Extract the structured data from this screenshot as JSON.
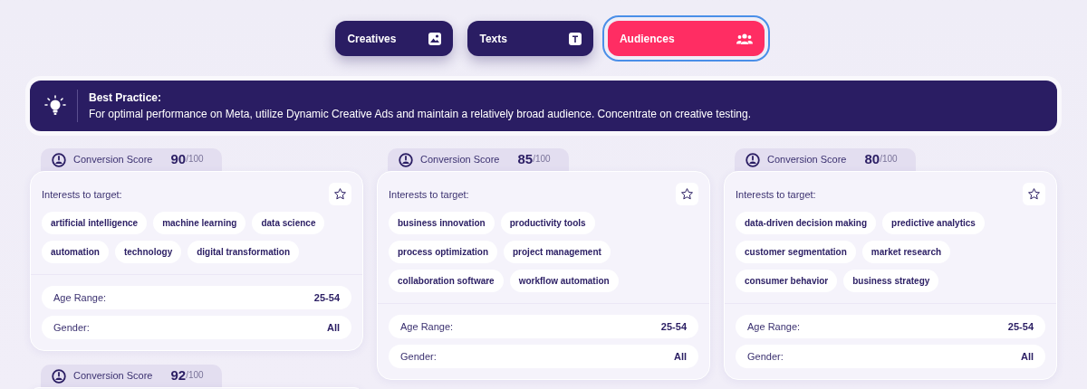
{
  "tabs": [
    {
      "label": "Creatives",
      "kind": "image",
      "selected": false
    },
    {
      "label": "Texts",
      "kind": "text",
      "selected": false
    },
    {
      "label": "Audiences",
      "kind": "people",
      "selected": true
    }
  ],
  "best_practice": {
    "title": "Best Practice:",
    "text": "For optimal performance on Meta, utilize Dynamic Creative Ads and maintain a relatively broad audience. Concentrate on creative testing."
  },
  "audiences": [
    {
      "score_label": "Conversion Score",
      "score": "90",
      "score_max": "/100",
      "interests_label": "Interests to target:",
      "interests": [
        "artificial intelligence",
        "machine learning",
        "data science",
        "automation",
        "technology",
        "digital transformation"
      ],
      "details": [
        {
          "label": "Age Range:",
          "value": "25-54"
        },
        {
          "label": "Gender:",
          "value": "All"
        }
      ]
    },
    {
      "score_label": "Conversion Score",
      "score": "85",
      "score_max": "/100",
      "interests_label": "Interests to target:",
      "interests": [
        "business innovation",
        "productivity tools",
        "process optimization",
        "project management",
        "collaboration software",
        "workflow automation"
      ],
      "details": [
        {
          "label": "Age Range:",
          "value": "25-54"
        },
        {
          "label": "Gender:",
          "value": "All"
        }
      ]
    },
    {
      "score_label": "Conversion Score",
      "score": "80",
      "score_max": "/100",
      "interests_label": "Interests to target:",
      "interests": [
        "data-driven decision making",
        "predictive analytics",
        "customer segmentation",
        "market research",
        "consumer behavior",
        "business strategy"
      ],
      "details": [
        {
          "label": "Age Range:",
          "value": "25-54"
        },
        {
          "label": "Gender:",
          "value": "All"
        }
      ]
    },
    {
      "score_label": "Conversion Score",
      "score": "92",
      "score_max": "/100"
    }
  ]
}
